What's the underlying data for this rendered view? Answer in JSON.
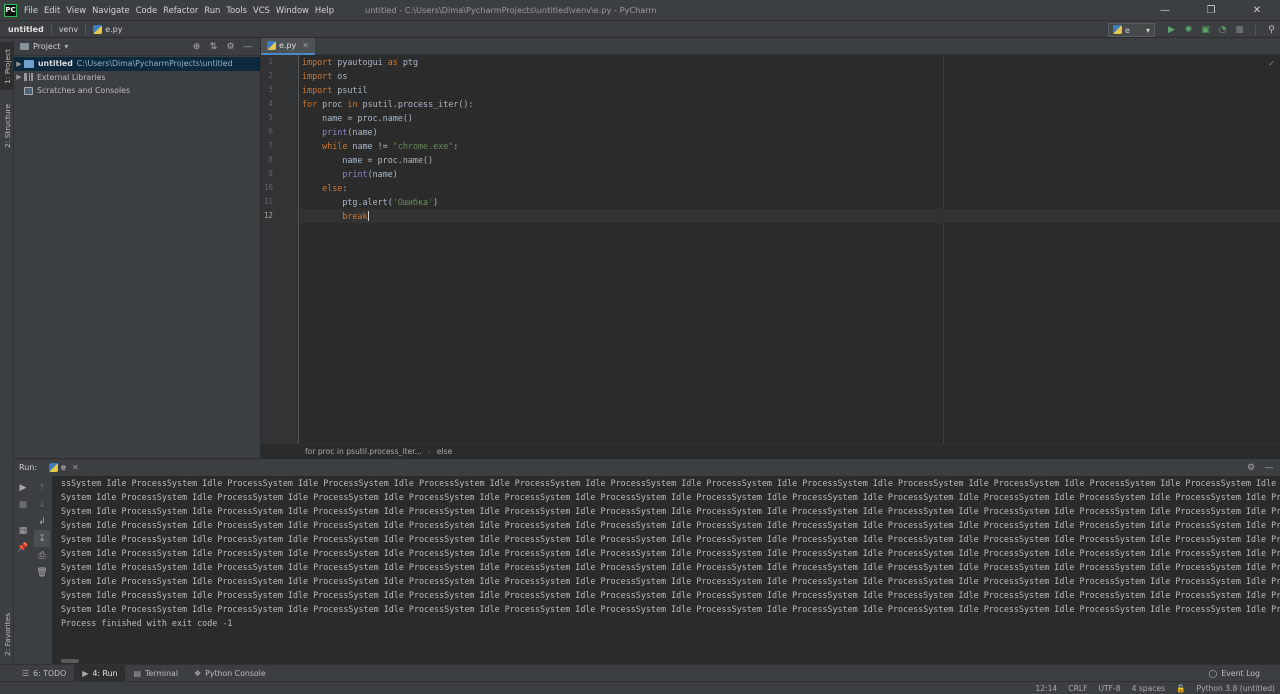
{
  "menubar": {
    "logo": "PC",
    "items": [
      "File",
      "Edit",
      "View",
      "Navigate",
      "Code",
      "Refactor",
      "Run",
      "Tools",
      "VCS",
      "Window",
      "Help"
    ],
    "window_title": "untitled - C:\\Users\\Dima\\PycharmProjects\\untitled\\venv\\e.py - PyCharm",
    "window_controls": [
      "minimize-icon",
      "restore-icon",
      "close-icon"
    ]
  },
  "navbar": {
    "crumbs": [
      "untitled",
      "venv",
      "e.py"
    ],
    "run_config": "e",
    "actions": [
      "run-icon",
      "debug-icon",
      "coverage-icon",
      "profile-icon",
      "stop-icon",
      "search-icon"
    ]
  },
  "left_stripe": {
    "project_tab": "1: Project",
    "structure_tab": "2: Structure",
    "favorites_tab": "2: Favorites"
  },
  "project_panel": {
    "title": "Project",
    "tree": [
      {
        "label": "untitled",
        "path": "C:\\Users\\Dima\\PycharmProjects\\untitled",
        "type": "folder",
        "selected": true
      },
      {
        "label": "External Libraries",
        "type": "library"
      },
      {
        "label": "Scratches and Consoles",
        "type": "scratch"
      }
    ]
  },
  "editor": {
    "tab": "e.py",
    "lines": [
      [
        [
          "kw",
          "import"
        ],
        [
          "t",
          " pyautogui "
        ],
        [
          "kw",
          "as"
        ],
        [
          "t",
          " ptg"
        ]
      ],
      [
        [
          "kw",
          "import"
        ],
        [
          "t",
          " os"
        ]
      ],
      [
        [
          "kw",
          "import"
        ],
        [
          "t",
          " psutil"
        ]
      ],
      [
        [
          "kw",
          "for"
        ],
        [
          "t",
          " proc "
        ],
        [
          "kw",
          "in"
        ],
        [
          "t",
          " psutil.process_iter():"
        ]
      ],
      [
        [
          "t",
          "    name = proc.name()"
        ]
      ],
      [
        [
          "t",
          "    "
        ],
        [
          "bi",
          "print"
        ],
        [
          "t",
          "(name)"
        ]
      ],
      [
        [
          "t",
          "    "
        ],
        [
          "kw",
          "while"
        ],
        [
          "t",
          " name != "
        ],
        [
          "st",
          "\"chrome.exe\""
        ],
        [
          "t",
          ":"
        ]
      ],
      [
        [
          "t",
          "        name = proc.name()"
        ]
      ],
      [
        [
          "t",
          "        "
        ],
        [
          "bi",
          "print"
        ],
        [
          "t",
          "(name)"
        ]
      ],
      [
        [
          "t",
          "    "
        ],
        [
          "kw",
          "else"
        ],
        [
          "t",
          ":"
        ]
      ],
      [
        [
          "t",
          "        ptg.alert("
        ],
        [
          "st",
          "'Ошибка'"
        ],
        [
          "t",
          ")"
        ]
      ],
      [
        [
          "t",
          "        "
        ],
        [
          "kw",
          "break"
        ],
        [
          "caret",
          ""
        ]
      ]
    ],
    "current_line": 12,
    "breadcrumbs": [
      "for proc in psutil.process_iter...",
      "else"
    ]
  },
  "run_panel": {
    "label": "Run:",
    "tab": "e",
    "output": [
      "ssSystem Idle ProcessSystem Idle ProcessSystem Idle ProcessSystem Idle ProcessSystem Idle ProcessSystem Idle ProcessSystem Idle ProcessSystem Idle ProcessSystem Idle ProcessSystem Idle ProcessSystem Idle ProcessSystem Idle ProcessSystem Idle Process",
      "System Idle ProcessSystem Idle ProcessSystem Idle ProcessSystem Idle ProcessSystem Idle ProcessSystem Idle ProcessSystem Idle ProcessSystem Idle ProcessSystem Idle ProcessSystem Idle ProcessSystem Idle ProcessSystem Idle ProcessSystem Idle Process",
      "System Idle ProcessSystem Idle ProcessSystem Idle ProcessSystem Idle ProcessSystem Idle ProcessSystem Idle ProcessSystem Idle ProcessSystem Idle ProcessSystem Idle ProcessSystem Idle ProcessSystem Idle ProcessSystem Idle ProcessSystem Idle Process",
      "System Idle ProcessSystem Idle ProcessSystem Idle ProcessSystem Idle ProcessSystem Idle ProcessSystem Idle ProcessSystem Idle ProcessSystem Idle ProcessSystem Idle ProcessSystem Idle ProcessSystem Idle ProcessSystem Idle ProcessSystem Idle Process",
      "System Idle ProcessSystem Idle ProcessSystem Idle ProcessSystem Idle ProcessSystem Idle ProcessSystem Idle ProcessSystem Idle ProcessSystem Idle ProcessSystem Idle ProcessSystem Idle ProcessSystem Idle ProcessSystem Idle ProcessSystem Idle Process",
      "System Idle ProcessSystem Idle ProcessSystem Idle ProcessSystem Idle ProcessSystem Idle ProcessSystem Idle ProcessSystem Idle ProcessSystem Idle ProcessSystem Idle ProcessSystem Idle ProcessSystem Idle ProcessSystem Idle ProcessSystem Idle Process",
      "System Idle ProcessSystem Idle ProcessSystem Idle ProcessSystem Idle ProcessSystem Idle ProcessSystem Idle ProcessSystem Idle ProcessSystem Idle ProcessSystem Idle ProcessSystem Idle ProcessSystem Idle ProcessSystem Idle ProcessSystem Idle Process",
      "System Idle ProcessSystem Idle ProcessSystem Idle ProcessSystem Idle ProcessSystem Idle ProcessSystem Idle ProcessSystem Idle ProcessSystem Idle ProcessSystem Idle ProcessSystem Idle ProcessSystem Idle ProcessSystem Idle ProcessSystem Idle Process",
      "System Idle ProcessSystem Idle ProcessSystem Idle ProcessSystem Idle ProcessSystem Idle ProcessSystem Idle ProcessSystem Idle ProcessSystem Idle ProcessSystem Idle ProcessSystem Idle ProcessSystem Idle ProcessSystem Idle ProcessSystem Idle Process",
      "System Idle ProcessSystem Idle ProcessSystem Idle ProcessSystem Idle ProcessSystem Idle ProcessSystem Idle ProcessSystem Idle ProcessSystem Idle ProcessSystem Idle ProcessSystem Idle ProcessSystem Idle ProcessSystem Idle ProcessSystem Idle Process",
      "Process finished with exit code -1"
    ]
  },
  "bottom_tabs": [
    {
      "label": "6: TODO",
      "icon": "list-icon",
      "active": false
    },
    {
      "label": "4: Run",
      "icon": "run-icon",
      "active": true
    },
    {
      "label": "Terminal",
      "icon": "terminal-icon",
      "active": false
    },
    {
      "label": "Python Console",
      "icon": "python-console-icon",
      "active": false
    }
  ],
  "event_log": "Event Log",
  "status_bar": {
    "position": "12:14",
    "line_sep": "CRLF",
    "encoding": "UTF-8",
    "indent": "4 spaces",
    "interpreter": "Python 3.8 (untitled)"
  },
  "colors": {
    "background": "#2b2b2b",
    "panel": "#3c3f41",
    "keyword": "#cc7832",
    "builtin": "#8888c6",
    "string": "#6a8759",
    "run_green": "#59a869",
    "selection": "#0d293e"
  }
}
